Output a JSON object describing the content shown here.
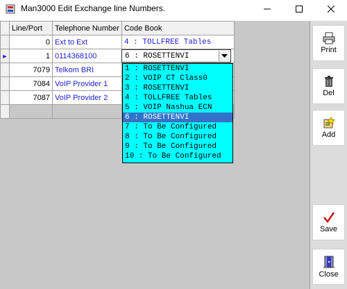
{
  "window": {
    "title": "Man3000 Edit Exchange line Numbers."
  },
  "grid": {
    "headers": [
      "Line/Port",
      "Telephone Number",
      "Code Book"
    ],
    "rows": [
      {
        "port": "0",
        "tel": "Ext to Ext",
        "code": "4 : TOLLFREE Tables"
      },
      {
        "port": "1",
        "tel": "0114368100",
        "code": ""
      },
      {
        "port": "7079",
        "tel": "Telkom BRI",
        "code": ""
      },
      {
        "port": "7084",
        "tel": "VoIP Provider 1",
        "code": ""
      },
      {
        "port": "7087",
        "tel": "VoIP Provider 2",
        "code": ""
      }
    ],
    "current_row_indicator": "►"
  },
  "combo": {
    "value": "6 : ROSETTENVI",
    "options": [
      "1 : ROSETTENVI",
      "2 : VOIP CT Class0",
      "3 : ROSETTENVI",
      "4 : TOLLFREE Tables",
      "5 : VOIP Nashua ECN",
      "6 : ROSETTENVI",
      "7 : To Be Configured",
      "8 : To Be Configured",
      "9 : To Be Configured",
      "10 : To Be Configured"
    ],
    "selected_index": 5
  },
  "toolbar": {
    "print": "Print",
    "del": "Del",
    "add": "Add",
    "save": "Save",
    "close": "Close"
  },
  "colors": {
    "dropdown_bg": "#00ffff",
    "selected_bg": "#3372c8",
    "link_text": "#1e1ed2"
  }
}
